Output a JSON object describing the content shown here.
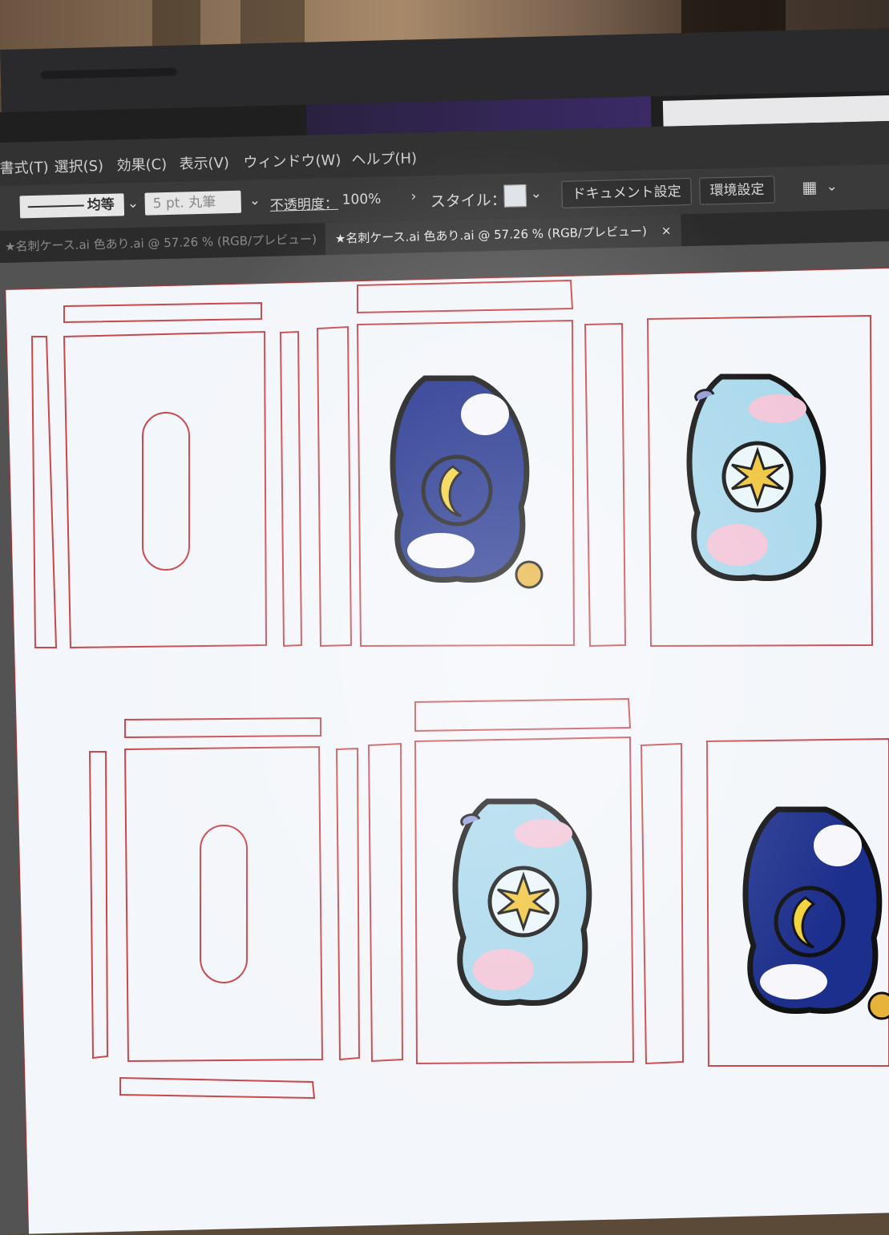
{
  "menu": {
    "items": [
      "書式(T)",
      "選択(S)",
      "効果(C)",
      "表示(V)",
      "ウィンドウ(W)",
      "ヘルプ(H)"
    ]
  },
  "control_bar": {
    "stroke_profile": "均等",
    "brush": "5 pt. 丸筆",
    "opacity_label": "不透明度：",
    "opacity_value": "100%",
    "style_label": "スタイル：",
    "document_setup_button": "ドキュメント設定",
    "preferences_button": "環境設定"
  },
  "tabs": [
    {
      "label": "★名刺ケース.ai 色あり.ai @ 57.26 % (RGB/プレビュー)",
      "active": false
    },
    {
      "label": "★名刺ケース.ai 色あり.ai @ 57.26 % (RGB/プレビュー)",
      "active": true
    }
  ],
  "colors": {
    "cut_line": "#c9484c",
    "navy": "#1d2f8c",
    "sky": "#a9d8ec",
    "pink": "#f2c5d8",
    "gold": "#f0c43a",
    "canvas": "#f3f6fa",
    "ui_dark": "#323232"
  },
  "icons": [
    "chevron-down-icon",
    "chevron-right-icon",
    "close-icon",
    "arrange-icon"
  ]
}
